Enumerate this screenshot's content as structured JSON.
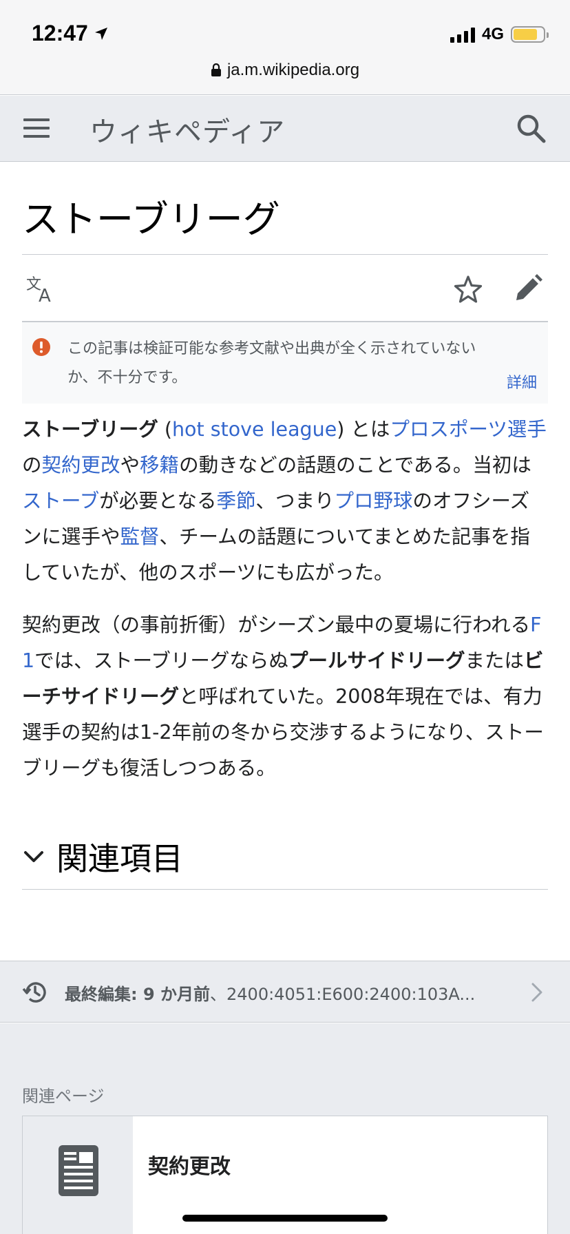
{
  "status_bar": {
    "time": "12:47",
    "network": "4G",
    "battery_level": 0.8,
    "url": "ja.m.wikipedia.org"
  },
  "header": {
    "wordmark": "ウィキペディア"
  },
  "article": {
    "title": "ストーブリーグ",
    "notice": {
      "text": "この記事は検証可能な参考文献や出典が全く示されていないか、不十分です。",
      "more": "詳細"
    },
    "para1": {
      "t1": "ストーブリーグ",
      "t2": " (",
      "l1": "hot stove league",
      "t3": ") とは",
      "l2": "プロスポーツ選手",
      "t4": "の",
      "l3": "契約更改",
      "t5": "や",
      "l4": "移籍",
      "t6": "の動きなどの話題のことである。当初は",
      "l5": "ストーブ",
      "t7": "が必要となる",
      "l6": "季節",
      "t8": "、つまり",
      "l7": "プロ野球",
      "t9": "のオフシーズンに選手や",
      "l8": "監督",
      "t10": "、チームの話題についてまとめた記事を指していたが、他のスポーツにも広がった。"
    },
    "para2": {
      "t1": "契約更改（の事前折衝）がシーズン最中の夏場に行われる",
      "l1": "F1",
      "t2": "では、ストーブリーグならぬ",
      "b1": "プールサイドリーグ",
      "t3": "または",
      "b2": "ビーチサイドリーグ",
      "t4": "と呼ばれていた。2008年現在では、有力選手の契約は1-2年前の冬から交渉するようになり、ストーブリーグも復活しつつある。"
    },
    "section_title": "関連項目"
  },
  "last_modified": {
    "label": "最終編集: 9 か月前",
    "separator": "、",
    "editor": "2400:4051:E600:2400:103A..."
  },
  "related": {
    "heading": "関連ページ",
    "items": [
      {
        "title": "契約更改"
      }
    ]
  },
  "colors": {
    "link": "#3366cc",
    "notice_icon": "#dd5b2b",
    "battery": "#f7ce46"
  }
}
